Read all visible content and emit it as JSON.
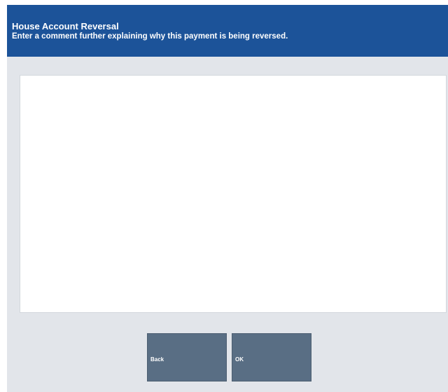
{
  "header": {
    "title": "House Account Reversal",
    "subtitle": "Enter a comment further explaining why this payment is being reversed."
  },
  "comment": {
    "value": "",
    "placeholder": ""
  },
  "buttons": {
    "back_label": "Back",
    "ok_label": "OK"
  },
  "colors": {
    "header_background": "#1c5399",
    "panel_background": "#e2e5ea",
    "button_background": "#596e84"
  }
}
